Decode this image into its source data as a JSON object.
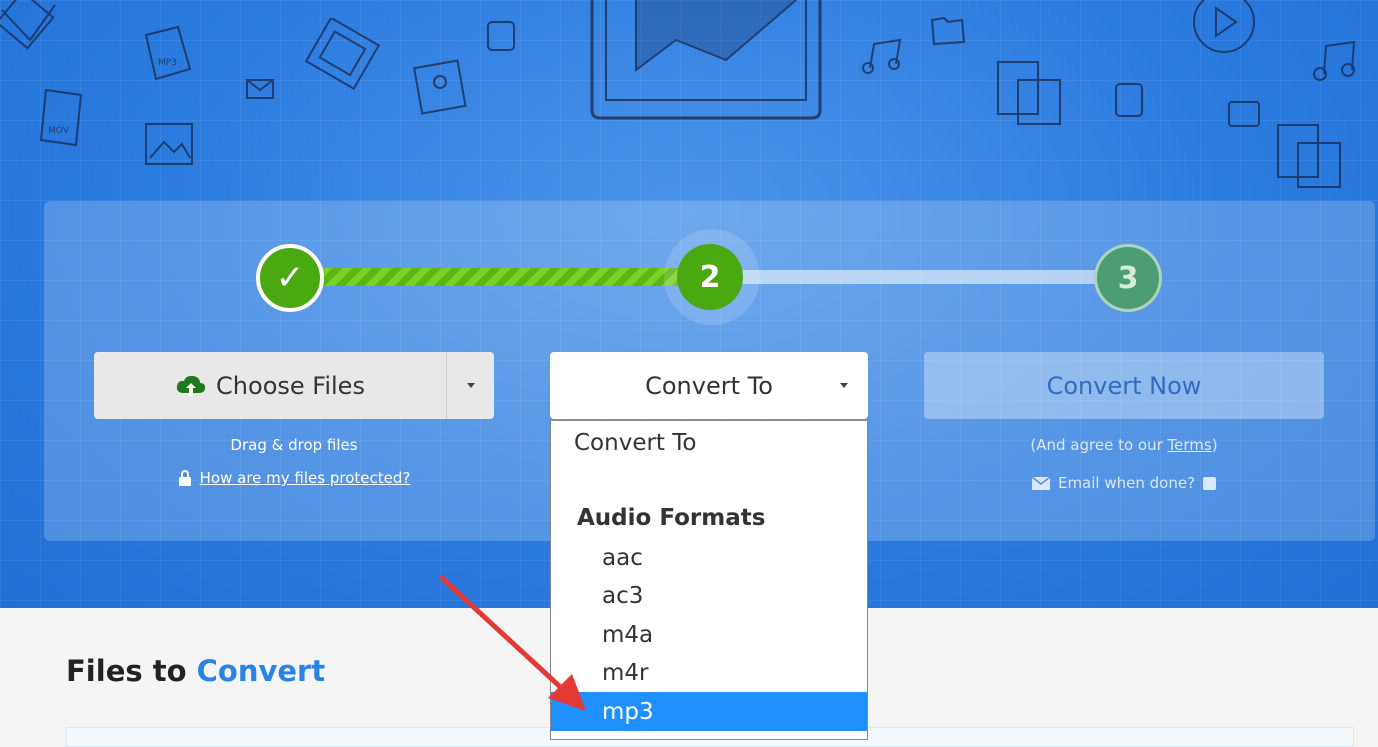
{
  "steps": [
    {
      "label": "✓"
    },
    {
      "label": "2"
    },
    {
      "label": "3"
    }
  ],
  "choose_files": {
    "label": "Choose Files",
    "icon": "cloud-upload-icon",
    "hint": "Drag & drop files",
    "protect_link": "How are my files protected?"
  },
  "convert_to": {
    "label": "Convert To"
  },
  "convert_now": {
    "label": "Convert Now",
    "agree_prefix": "(And agree to our ",
    "terms": "Terms",
    "agree_suffix": ")",
    "email": "Email when done?"
  },
  "dropdown": {
    "placeholder": "Convert To",
    "group": "Audio Formats",
    "options": [
      "aac",
      "ac3",
      "m4a",
      "m4r",
      "mp3"
    ],
    "selected": "mp3"
  },
  "files_section": {
    "title_part1": "Files to ",
    "title_part2": "Convert"
  },
  "colors": {
    "hero_blue": "#2a7be0",
    "step_green": "#4aa811",
    "selected_blue": "#1e90ff",
    "arrow_red": "#e53935"
  }
}
